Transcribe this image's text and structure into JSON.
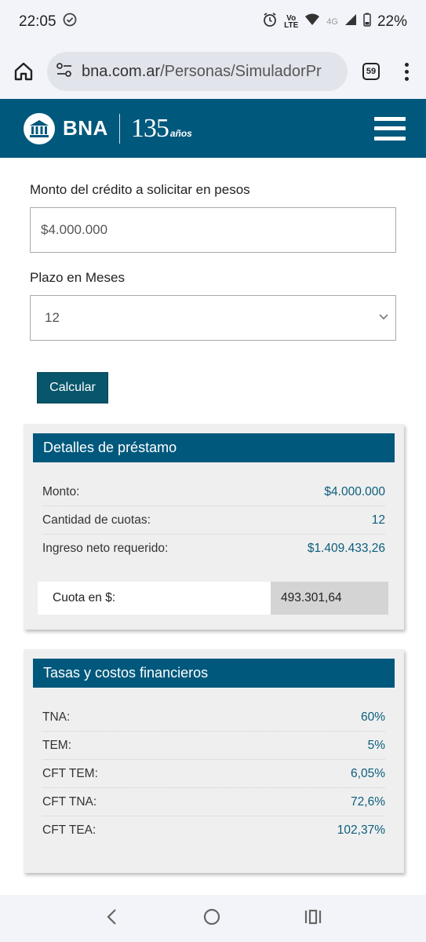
{
  "status": {
    "time": "22:05",
    "volte_top": "Vo",
    "volte_bottom": "LTE",
    "net": "4G",
    "battery": "22%"
  },
  "browser": {
    "url_host": "bna.com.ar",
    "url_path": "/Personas/SimuladorPr",
    "tab_count": "59"
  },
  "site": {
    "brand": "BNA",
    "anniversary_number": "135",
    "anniversary_word": "años"
  },
  "form": {
    "amount_label": "Monto del crédito a solicitar en pesos",
    "amount_value": "$4.000.000",
    "term_label": "Plazo en Meses",
    "term_value": "12",
    "submit_label": "Calcular"
  },
  "details": {
    "title": "Detalles de préstamo",
    "rows": [
      {
        "label": "Monto:",
        "value": "$4.000.000"
      },
      {
        "label": "Cantidad de cuotas:",
        "value": "12"
      },
      {
        "label": "Ingreso neto requerido:",
        "value": "$1.409.433,26"
      }
    ],
    "cuota_label": "Cuota en $:",
    "cuota_value": "493.301,64"
  },
  "rates": {
    "title": "Tasas y costos financieros",
    "rows": [
      {
        "label": "TNA:",
        "value": "60%"
      },
      {
        "label": "TEM:",
        "value": "5%"
      },
      {
        "label": "CFT TEM:",
        "value": "6,05%"
      },
      {
        "label": "CFT TNA:",
        "value": "72,6%"
      },
      {
        "label": "CFT TEA:",
        "value": "102,37%"
      }
    ]
  },
  "colors": {
    "brand": "#00587c",
    "button": "#07566b",
    "value_text": "#0b5e7d",
    "panel_bg": "#efefef"
  }
}
